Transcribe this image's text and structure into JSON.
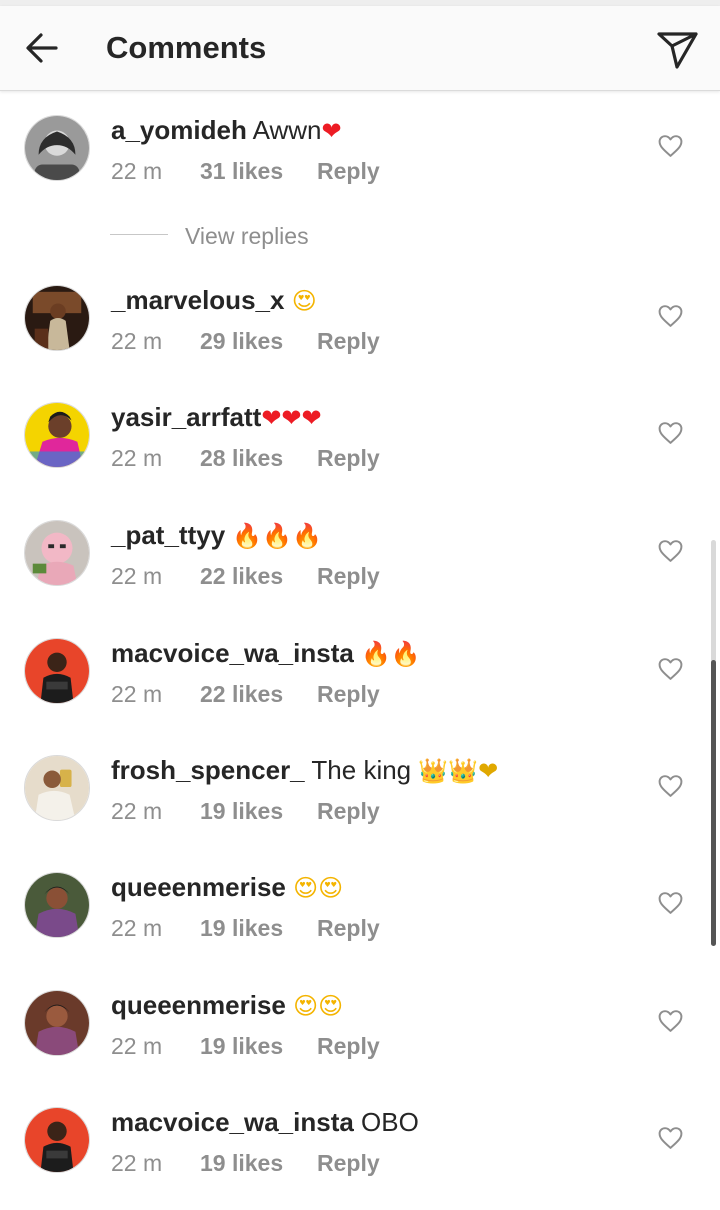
{
  "header": {
    "title": "Comments",
    "back_icon": "arrow-left-icon",
    "send_icon": "paper-plane-icon"
  },
  "view_replies_label": "View replies",
  "comments": [
    {
      "username": "a_yomideh",
      "text": "Awwn",
      "emoji": "❤",
      "time": "22 m",
      "likes": "31 likes",
      "reply": "Reply"
    },
    {
      "username": "_marvelous_x",
      "text": "",
      "emoji": "😍",
      "time": "22 m",
      "likes": "29 likes",
      "reply": "Reply"
    },
    {
      "username": "yasir_arrfatt",
      "text": "",
      "emoji": "❤❤❤",
      "time": "22 m",
      "likes": "28 likes",
      "reply": "Reply"
    },
    {
      "username": "_pat_ttyy",
      "text": "",
      "emoji": "🔥🔥🔥",
      "time": "22 m",
      "likes": "22 likes",
      "reply": "Reply"
    },
    {
      "username": "macvoice_wa_insta",
      "text": "",
      "emoji": "🔥🔥",
      "time": "22 m",
      "likes": "22 likes",
      "reply": "Reply"
    },
    {
      "username": "frosh_spencer_",
      "text": "The king",
      "emoji": "👑👑❤",
      "time": "22 m",
      "likes": "19 likes",
      "reply": "Reply"
    },
    {
      "username": "queeenmerise",
      "text": "",
      "emoji": "😍😍",
      "time": "22 m",
      "likes": "19 likes",
      "reply": "Reply"
    },
    {
      "username": "queeenmerise",
      "text": "",
      "emoji": "😍😍",
      "time": "22 m",
      "likes": "19 likes",
      "reply": "Reply"
    },
    {
      "username": "macvoice_wa_insta",
      "text": "OBO",
      "emoji": "",
      "time": "22 m",
      "likes": "19 likes",
      "reply": "Reply"
    }
  ],
  "colors": {
    "text": "#262626",
    "meta": "#8e8e8e",
    "header_bg": "#fafafa",
    "heart_emoji": "#ed1c24"
  }
}
